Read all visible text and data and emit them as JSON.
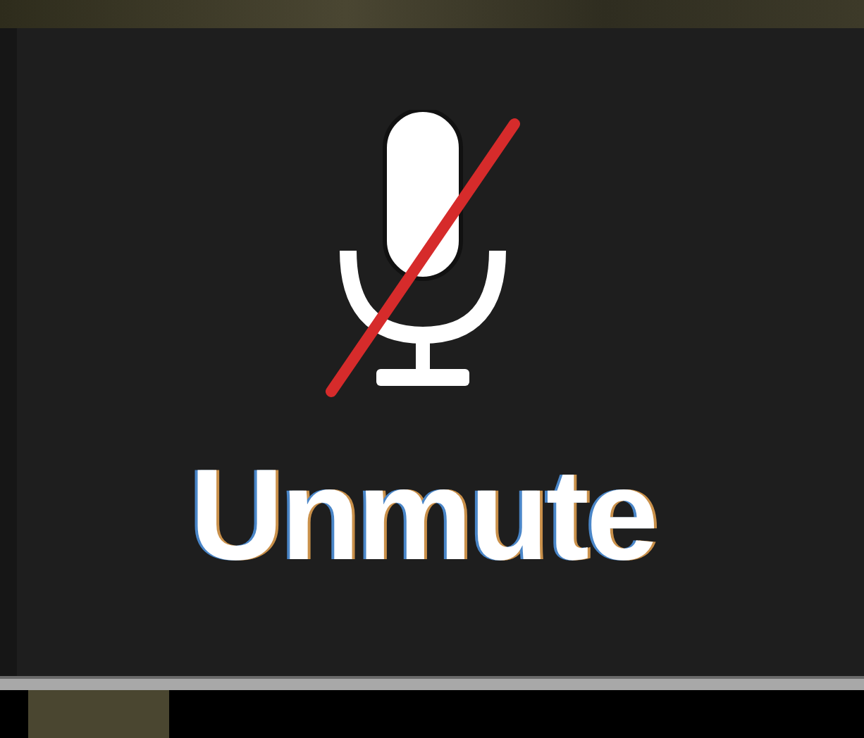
{
  "button": {
    "label": "Unmute",
    "muted": true
  }
}
